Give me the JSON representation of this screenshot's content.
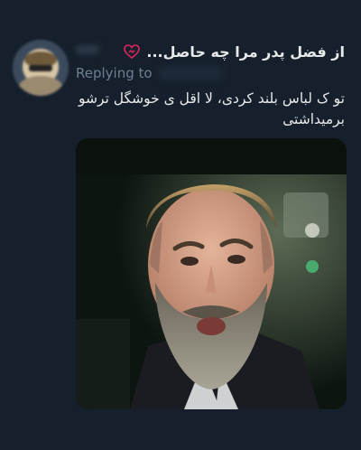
{
  "tweet": {
    "display_name": "از فضل پدر مرا چه حاصل...",
    "replying_to_label": "Replying to",
    "text_line1": "تو ک لباس بلند کردی، لا اقل ی خوشگل ترشو",
    "text_line2": "برمیداشتی",
    "heart_color": "#e0245e"
  },
  "colors": {
    "background": "#16202d",
    "text": "#e7e9ea",
    "secondary_text": "#6e7f91"
  },
  "media": {
    "icon": "meme-photo-bearded-man-in-car"
  }
}
